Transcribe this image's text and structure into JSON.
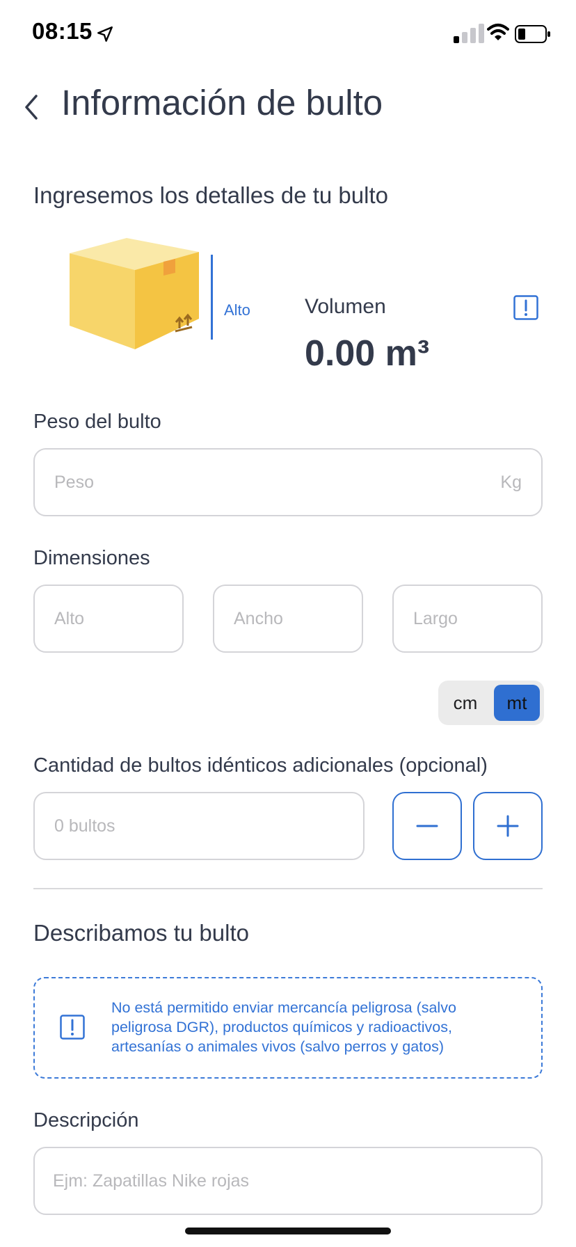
{
  "status_bar": {
    "time": "08:15"
  },
  "header": {
    "title": "Información de bulto"
  },
  "package_details": {
    "heading": "Ingresemos los detalles de tu bulto",
    "height_label": "Alto",
    "volume_label": "Volumen",
    "volume_value": "0.00 m³"
  },
  "weight": {
    "label": "Peso del bulto",
    "placeholder": "Peso",
    "unit": "Kg"
  },
  "dimensions": {
    "label": "Dimensiones",
    "height_placeholder": "Alto",
    "width_placeholder": "Ancho",
    "length_placeholder": "Largo",
    "unit_options": [
      "cm",
      "mt"
    ],
    "selected_unit": "mt"
  },
  "quantity": {
    "label": "Cantidad de bultos idénticos adicionales (opcional)",
    "placeholder": "0 bultos"
  },
  "description_section": {
    "heading": "Describamos tu bulto",
    "notice": "No está permitido enviar mercancía peligrosa (salvo peligrosa DGR), productos químicos y radioactivos, artesanías o animales vivos (salvo perros y gatos)",
    "label": "Descripción",
    "placeholder": "Ejm: Zapatillas Nike rojas"
  },
  "colors": {
    "accent": "#2f6fd1",
    "text": "#333a4b",
    "border": "#d4d4d8",
    "box": "#f6cf5e"
  },
  "icons": [
    "location-arrow-icon",
    "signal-icon",
    "wifi-icon",
    "battery-icon",
    "back-chevron-icon",
    "info-icon",
    "minus-icon",
    "plus-icon"
  ]
}
